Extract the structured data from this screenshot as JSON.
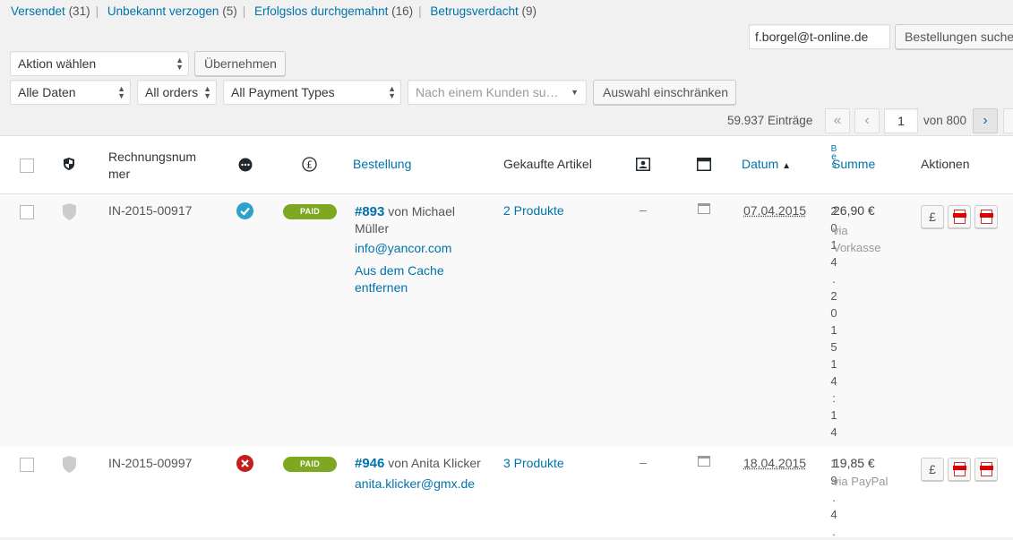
{
  "status_links": [
    {
      "label": "Versendet",
      "count": "(31)"
    },
    {
      "label": "Unbekannt verzogen",
      "count": "(5)"
    },
    {
      "label": "Erfolgslos durchgemahnt",
      "count": "(16)"
    },
    {
      "label": "Betrugsverdacht",
      "count": "(9)"
    }
  ],
  "search": {
    "value": "f.borgel@t-online.de",
    "button": "Bestellungen suchen"
  },
  "bulk": {
    "select": "Aktion wählen",
    "apply": "Übernehmen"
  },
  "filters": {
    "dates": "Alle Daten",
    "orders": "All orders",
    "payment": "All Payment Types",
    "customer_placeholder": "Nach einem Kunden su…",
    "filter_button": "Auswahl einschränken"
  },
  "pagination": {
    "items": "59.937 Einträge",
    "first": "«",
    "prev": "‹",
    "current": "1",
    "of": "von 800",
    "next": "›"
  },
  "columns": {
    "invoice": "Rechnungsnum mer",
    "order": "Bestellung",
    "products": "Gekaufte Artikel",
    "date": "Datum",
    "sum": "Summe",
    "actions": "Aktionen"
  },
  "rows": [
    {
      "invoice": "IN-2015-00917",
      "status": "PAID",
      "order_no": "#893",
      "von": "von Michael Müller",
      "email": "info@yancor.com",
      "cache": "Aus dem Cache entfernen",
      "products": "2 Produkte",
      "dash": "–",
      "date": "07.04.2015",
      "sum": "26,90 €",
      "via": "via Vorkasse",
      "vertical": [
        "2",
        "0",
        "1",
        "4",
        ".",
        "2",
        "0",
        "1",
        "5",
        "1",
        "4",
        ":",
        "1",
        "4"
      ]
    },
    {
      "invoice": "IN-2015-00997",
      "status": "PAID",
      "order_no": "#946",
      "von": "von Anita Klicker",
      "email": "anita.klicker@gmx.de",
      "products": "3 Produkte",
      "dash": "–",
      "date": "18.04.2015",
      "sum": "19,85 €",
      "via": "via PayPal",
      "vertical": [
        "1",
        "9",
        ".",
        "4",
        "."
      ]
    }
  ],
  "action_icons": [
    "pound-icon",
    "pdf-invoice-icon",
    "pdf-document-icon"
  ],
  "colors": {
    "link": "#0073aa",
    "paid": "#7ea821",
    "check": "#2ea2cc",
    "error": "#c41f1f"
  }
}
